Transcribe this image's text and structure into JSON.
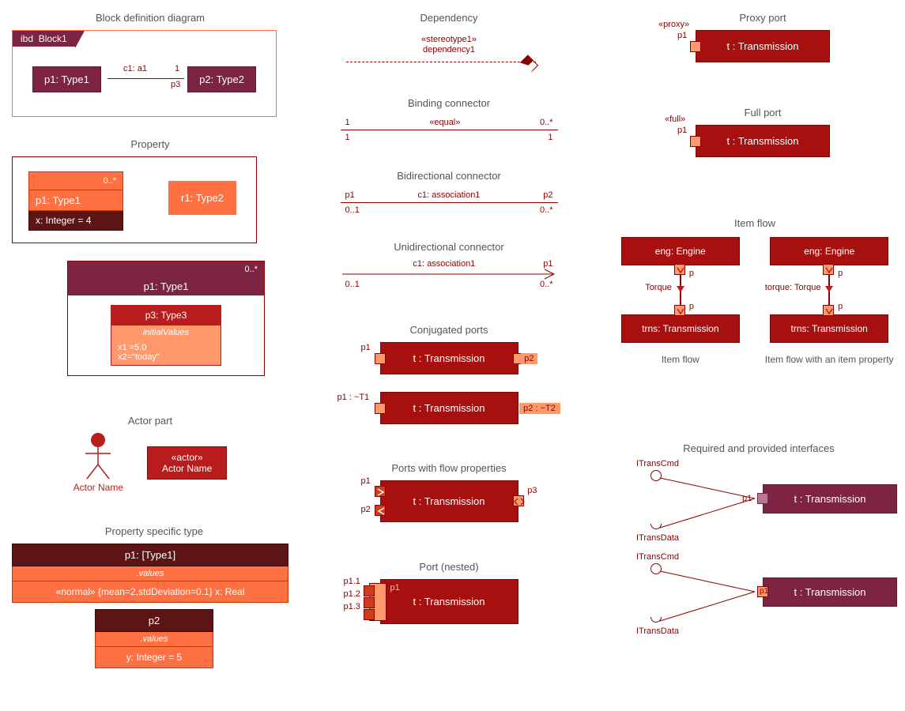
{
  "col1": {
    "bdd_title": "Block definition diagram",
    "bdd_tab_prefix": "ibd",
    "bdd_tab_name": "Block1",
    "bdd_p1": "p1: Type1",
    "bdd_p2": "p2: Type2",
    "bdd_conn": "c1: a1",
    "bdd_m1": "1",
    "bdd_m3": "p3",
    "property_title": "Property",
    "prop1_mult": "0..*",
    "prop1_name": "p1: Type1",
    "prop1_attr": "x: Integer = 4",
    "prop2_name": "r1: Type2",
    "nested_mult": "0..*",
    "nested_name": "p1: Type1",
    "nested_inner": "p3: Type3",
    "nested_init_label": "initialValues",
    "nested_vals_1": "x1 =5.0",
    "nested_vals_2": "x2=\"today\"",
    "actor_title": "Actor part",
    "actor_name": "Actor Name",
    "actor_stereotype": "«actor»",
    "actor_box_name": "Actor Name",
    "pst_title": "Property specific type",
    "pst_head": "p1: [Type1]",
    "pst_values_label": ".values",
    "pst_body": "«normal» {mean=2,stdDeviation=0.1} x: Real",
    "pst2_head": "p2",
    "pst2_values_label": ".values",
    "pst2_body": "y: Integer = 5"
  },
  "col2": {
    "dep_title": "Dependency",
    "dep_stereo": "«stereotype1»",
    "dep_name": "dependency1",
    "bind_title": "Binding connector",
    "bind_equal": "«equal»",
    "bind_r1c1": "1",
    "bind_r1c2": "0..*",
    "bind_r2c1": "1",
    "bind_r2c2": "1",
    "bidir_title": "Bidirectional connector",
    "bidir_r1c1": "p1",
    "bidir_r1c2": "c1: association1",
    "bidir_r1c3": "p2",
    "bidir_r2c1": "0..1",
    "bidir_r2c2": "0..*",
    "unidir_title": "Unidirectional connector",
    "unidir_label": "c1: association1",
    "unidir_p1": "p1",
    "unidir_r2c1": "0..1",
    "unidir_r2c2": "0..*",
    "conj_title": "Conjugated ports",
    "conj1_text": "t : Transmission",
    "conj1_p1": "p1",
    "conj1_p2": "p2",
    "conj2_text": "t : Transmission",
    "conj2_p1": "p1 : ~T1",
    "conj2_p2": "p2 : ~T2",
    "flowprop_title": "Ports with flow properties",
    "flowprop_text": "t : Transmission",
    "flowprop_p1": "p1",
    "flowprop_p2": "p2",
    "flowprop_p3": "p3",
    "nested_title": "Port (nested)",
    "nested_text": "t : Transmission",
    "nested_p1": "p1",
    "nested_p11": "p1.1",
    "nested_p12": "p1.2",
    "nested_p13": "p1.3"
  },
  "col3": {
    "proxy_title": "Proxy port",
    "proxy_stereo": "«proxy»",
    "proxy_p1": "p1",
    "proxy_text": "t : Transmission",
    "full_title": "Full port",
    "full_stereo": "«full»",
    "full_p1": "p1",
    "full_text": "t : Transmission",
    "itemflow_title": "Item flow",
    "itemflow_eng": "eng: Engine",
    "itemflow_trns": "trns: Transmission",
    "itemflow_p": "p",
    "itemflow_label1": "Torque",
    "itemflow_label2": "torque: Torque",
    "itemflow_sub1": "Item flow",
    "itemflow_sub2": "Item flow with an item property",
    "iface_title": "Required and provided interfaces",
    "iface_text": "t : Transmission",
    "iface_cmd": "ITransCmd",
    "iface_data": "ITransData",
    "iface_p1": "p1"
  }
}
